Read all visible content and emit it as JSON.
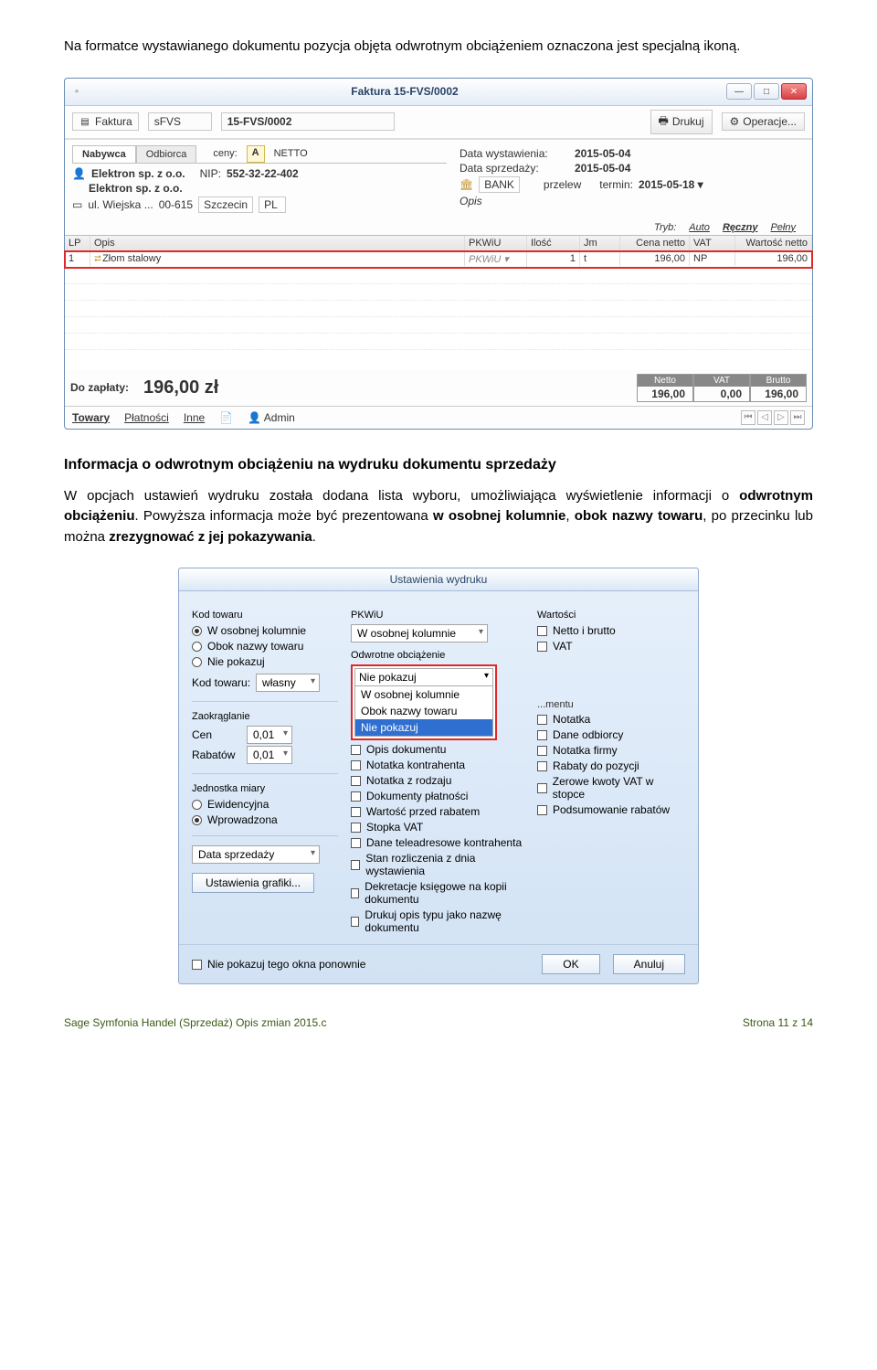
{
  "intro_para": "Na formatce wystawianego dokumentu pozycja objęta odwrotnym obciążeniem oznaczona jest specjalną ikoną.",
  "win1": {
    "title": "Faktura 15-FVS/0002",
    "min": "—",
    "max": "□",
    "close": "✕",
    "toolbar": {
      "type": "Faktura",
      "code": "sFVS",
      "number": "15-FVS/0002",
      "print": "Drukuj",
      "ops": "Operacje..."
    },
    "tabs": {
      "buyer": "Nabywca",
      "recipient": "Odbiorca",
      "prices_lbl": "ceny:",
      "prices_ind": "A",
      "prices_val": "NETTO"
    },
    "party": {
      "name": "Elektron sp. z o.o.",
      "nip_lbl": "NIP:",
      "nip": "552-32-22-402",
      "name2": "Elektron sp. z o.o.",
      "street": "ul. Wiejska ...",
      "zip": "00-615",
      "city": "Szczecin",
      "country": "PL"
    },
    "dates": {
      "issue_lbl": "Data wystawienia:",
      "issue": "2015-05-04",
      "sale_lbl": "Data sprzedaży:",
      "sale": "2015-05-04",
      "bank": "BANK",
      "method": "przelew",
      "term_lbl": "termin:",
      "term": "2015-05-18 ▾",
      "desc_lbl": "Opis"
    },
    "mode": {
      "lbl": "Tryb:",
      "auto": "Auto",
      "manual": "Ręczny",
      "full": "Pełny"
    },
    "cols": {
      "lp": "LP",
      "opis": "Opis",
      "pk": "PKWiU",
      "il": "Ilość",
      "jm": "Jm",
      "cn": "Cena netto",
      "vat": "VAT",
      "wn": "Wartość netto"
    },
    "row": {
      "lp": "1",
      "opis": "Złom stalowy",
      "pk": "PKWiU ▾",
      "il": "1",
      "jm": "t",
      "cn": "196,00",
      "vat": "NP",
      "wn": "196,00"
    },
    "pay_lbl": "Do zapłaty:",
    "pay": "196,00  zł",
    "totals": {
      "netto_h": "Netto",
      "netto": "196,00",
      "vat_h": "VAT",
      "vat": "0,00",
      "brutto_h": "Brutto",
      "brutto": "196,00"
    },
    "bottom": {
      "towary": "Towary",
      "plat": "Płatności",
      "inne": "Inne",
      "admin": "Admin"
    }
  },
  "section_heading": "Informacja o odwrotnym obciążeniu na wydruku dokumentu sprzedaży",
  "section_para_1": "W opcjach ustawień wydruku została dodana lista wyboru, umożliwiająca wyświetlenie informacji o ",
  "section_para_strong": "odwrotnym obciążeniu",
  "section_para_2": ". Powyższa informacja może być prezentowana ",
  "section_para_bold2": "w osobnej kolumnie",
  "section_para_3": ", ",
  "section_para_bold3": "obok nazwy towaru",
  "section_para_4": ", po przecinku lub można ",
  "section_para_bold4": "zrezygnować z jej pokazywania",
  "section_para_5": ".",
  "dlg": {
    "title": "Ustawienia wydruku",
    "colA": {
      "kod_label": "Kod towaru",
      "r1": "W osobnej kolumnie",
      "r2": "Obok nazwy towaru",
      "r3": "Nie pokazuj",
      "kod_t_lbl": "Kod towaru:",
      "kod_t_val": "własny",
      "zaok": "Zaokrąglanie",
      "cen": "Cen",
      "cen_v": "0,01",
      "rab": "Rabatów",
      "rab_v": "0,01",
      "jm": "Jednostka miary",
      "jm1": "Ewidencyjna",
      "jm2": "Wprowadzona",
      "data_sel": "Data sprzedaży",
      "graf_btn": "Ustawienia grafiki..."
    },
    "colB": {
      "pk_lbl": "PKWiU",
      "pk_sel": "W osobnej kolumnie",
      "oo_lbl": "Odwrotne obciążenie",
      "oo_sel": "Nie pokazuj",
      "dd": [
        "W osobnej kolumnie",
        "Obok nazwy towaru",
        "Nie pokazuj"
      ],
      "chks": [
        "Opis dokumentu",
        "Notatka kontrahenta",
        "Notatka z rodzaju",
        "Dokumenty płatności",
        "Wartość przed rabatem",
        "Stopka VAT",
        "Dane teleadresowe kontrahenta",
        "Stan rozliczenia z dnia wystawienia",
        "Dekretacje księgowe na kopii dokumentu",
        "Drukuj opis typu jako nazwę dokumentu"
      ],
      "partial_label": "...mentu"
    },
    "colC": {
      "wart": "Wartości",
      "w1": "Netto i brutto",
      "w2": "VAT",
      "chks": [
        "Notatka",
        "Dane odbiorcy",
        "Notatka firmy",
        "Rabaty do pozycji",
        "Zerowe kwoty VAT w stopce",
        "Podsumowanie rabatów"
      ]
    },
    "footer": {
      "no_show": "Nie pokazuj tego okna ponownie",
      "ok": "OK",
      "cancel": "Anuluj"
    }
  },
  "footer": {
    "left": "Sage Symfonia Handel (Sprzedaż) Opis zmian 2015.c",
    "right": "Strona 11 z 14"
  }
}
